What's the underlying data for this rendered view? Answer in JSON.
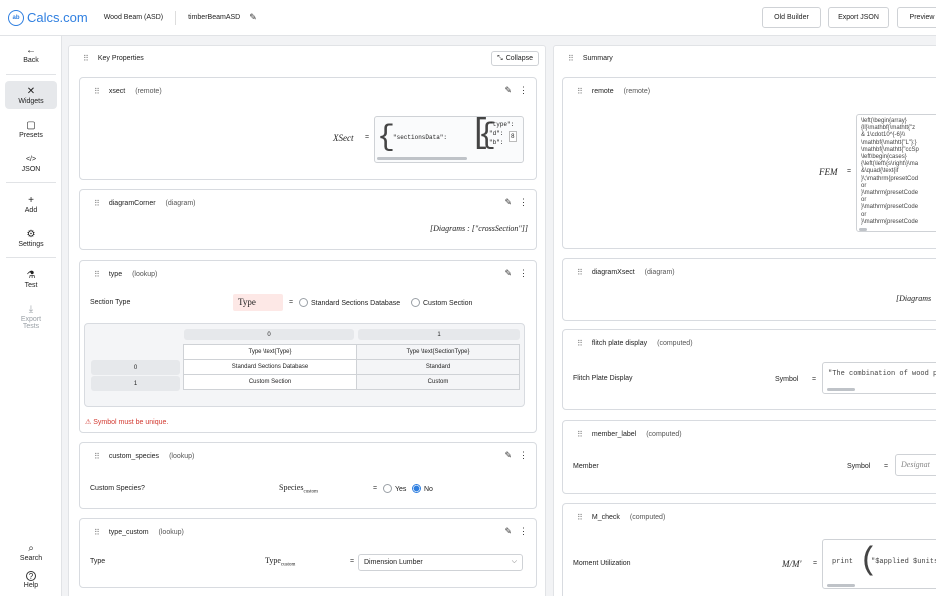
{
  "topbar": {
    "logo_text": "Calcs.com",
    "logo_mark": "ab",
    "calc_name": "Wood Beam (ASD)",
    "calc_id": "timberBeamASD",
    "buttons": [
      "Old Builder",
      "Export JSON",
      "Preview"
    ]
  },
  "sidebar": {
    "items": [
      {
        "icon": "←",
        "label": "Back"
      },
      {
        "icon": "✕",
        "label": "Widgets"
      },
      {
        "icon": "▢",
        "label": "Presets"
      },
      {
        "icon": "</>",
        "label": "JSON"
      },
      {
        "icon": "+",
        "label": "Add"
      },
      {
        "icon": "⚙",
        "label": "Settings"
      },
      {
        "icon": "⚗",
        "label": "Test"
      },
      {
        "icon": "⤓",
        "label": "Export Tests"
      },
      {
        "icon": "⌕",
        "label": "Search"
      },
      {
        "icon": "?",
        "label": "Help"
      }
    ]
  },
  "key_properties": {
    "title": "Key Properties",
    "collapse_label": "Collapse",
    "cards": {
      "xsect": {
        "name": "xsect",
        "kind": "(remote)",
        "symbol": "XSect",
        "code_key": "\"sectionsData\":",
        "code_lines": [
          "\"type\":",
          "\"d\":",
          "\"b\":"
        ],
        "code_num": "8"
      },
      "diagramCorner": {
        "name": "diagramCorner",
        "kind": "(diagram)",
        "value": "[Diagrams : [\"crossSection\"]]"
      },
      "type": {
        "name": "type",
        "kind": "(lookup)",
        "label": "Section Type",
        "symbol": "Type",
        "options": [
          "Standard Sections Database",
          "Custom Section"
        ],
        "table": {
          "col_heads": [
            "0",
            "1"
          ],
          "headers": [
            "Type  \\text{Type}",
            "Type  \\text{SectionType}"
          ],
          "row_heads": [
            "0",
            "1"
          ],
          "rows": [
            [
              "Standard Sections Database",
              "Standard"
            ],
            [
              "Custom Section",
              "Custom"
            ]
          ]
        },
        "error": "Symbol must be unique."
      },
      "custom_species": {
        "name": "custom_species",
        "kind": "(lookup)",
        "label": "Custom Species?",
        "symbol": "Species",
        "subscript": "custom",
        "options": [
          "Yes",
          "No"
        ],
        "selected": "No"
      },
      "type_custom": {
        "name": "type_custom",
        "kind": "(lookup)",
        "label": "Type",
        "symbol": "Type",
        "subscript": "custom",
        "select_value": "Dimension Lumber"
      }
    }
  },
  "summary": {
    "title": "Summary",
    "cards": {
      "remote": {
        "name": "remote",
        "kind": "(remote)",
        "symbol": "FEM",
        "latex": "\\left(\\begin{array}\n{ll}\\mathbf{\\mathtt{\"z\n& 1\\cdot10^{-6}\\\\\n\\mathbf{\\mathtt{\"L\"}:}\n\\mathbf{\\mathtt{\"ccSp\n\\left\\begin{cases}\n{\\left(\\left\\{s\\right\\}\\ma\n&\\quad{\\text{if\n}\\;\\mathrm{presetCod\nor\n}\\mathrm{presetCode\nor\n}\\mathrm{presetCode\nor\n}\\mathrm{presetCode"
      },
      "diagramXsect": {
        "name": "diagramXsect",
        "kind": "(diagram)",
        "value": "[Diagrams"
      },
      "flitch": {
        "name": "flitch plate display",
        "kind": "(computed)",
        "label": "Flitch Plate Display",
        "sym_label": "Symbol",
        "code": "\"The combination of wood p"
      },
      "member_label": {
        "name": "member_label",
        "kind": "(computed)",
        "label": "Member",
        "sym_label": "Symbol",
        "code": "Designat"
      },
      "M_check": {
        "name": "M_check",
        "kind": "(computed)",
        "label": "Moment Utilization",
        "symbol": "M/M'",
        "code_print": "print",
        "code": "\"$applied $units /"
      }
    }
  }
}
